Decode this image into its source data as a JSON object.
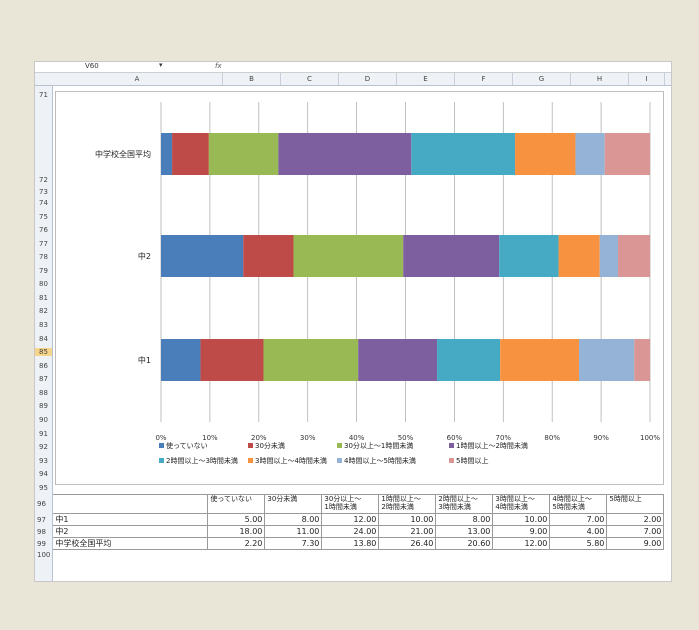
{
  "formula_bar": {
    "name_box": "V60",
    "dropdown": "▾",
    "fx": "fx"
  },
  "columns": [
    "A",
    "B",
    "C",
    "D",
    "E",
    "F",
    "G",
    "H",
    "I"
  ],
  "rows_top": [
    "71",
    "72",
    "73",
    "74",
    "75",
    "76",
    "77",
    "78",
    "79",
    "80",
    "81",
    "82",
    "83",
    "84",
    "85",
    "86",
    "87",
    "88",
    "89",
    "90",
    "91",
    "92",
    "93",
    "94",
    "95"
  ],
  "rows_table": [
    "96",
    "97",
    "98",
    "99",
    "100"
  ],
  "chart_data": {
    "type": "bar",
    "orientation": "horizontal",
    "stacked": "percent",
    "categories": [
      "中学校全国平均",
      "中2",
      "中1"
    ],
    "xticks": [
      "0%",
      "10%",
      "20%",
      "30%",
      "40%",
      "50%",
      "60%",
      "70%",
      "80%",
      "90%",
      "100%"
    ],
    "xlim": [
      0,
      100
    ],
    "grid": true,
    "legend_position": "bottom",
    "series": [
      {
        "name": "使っていない",
        "color": "#4a7ebb",
        "values": [
          2.2,
          18.0,
          5.0
        ]
      },
      {
        "name": "30分未満",
        "color": "#be4b48",
        "values": [
          7.3,
          11.0,
          8.0
        ]
      },
      {
        "name": "30分以上～1時間未満",
        "color": "#98b954",
        "values": [
          13.8,
          24.0,
          12.0
        ]
      },
      {
        "name": "1時間以上～2時間未満",
        "color": "#7d5fa0",
        "values": [
          26.4,
          21.0,
          10.0
        ]
      },
      {
        "name": "2時間以上～3時間未満",
        "color": "#46aac4",
        "values": [
          20.6,
          13.0,
          8.0
        ]
      },
      {
        "name": "3時間以上～4時間未満",
        "color": "#f69240",
        "values": [
          12.0,
          9.0,
          10.0
        ]
      },
      {
        "name": "4時間以上～5時間未満",
        "color": "#95b3d7",
        "values": [
          5.8,
          4.0,
          7.0
        ]
      },
      {
        "name": "5時間以上",
        "color": "#d99694",
        "values": [
          9.0,
          7.0,
          2.0
        ]
      }
    ]
  },
  "table": {
    "headers": [
      "使っていない",
      "30分未満",
      "30分以上～\n1時間未満",
      "1時間以上～\n2時間未満",
      "2時間以上～\n3時間未満",
      "3時間以上～\n4時間未満",
      "4時間以上～\n5時間未満",
      "5時間以上"
    ],
    "rows": [
      {
        "label": "中1",
        "values": [
          "5.00",
          "8.00",
          "12.00",
          "10.00",
          "8.00",
          "10.00",
          "7.00",
          "2.00"
        ]
      },
      {
        "label": "中2",
        "values": [
          "18.00",
          "11.00",
          "24.00",
          "21.00",
          "13.00",
          "9.00",
          "4.00",
          "7.00"
        ]
      },
      {
        "label": "中学校全国平均",
        "values": [
          "2.20",
          "7.30",
          "13.80",
          "26.40",
          "20.60",
          "12.00",
          "5.80",
          "9.00"
        ]
      }
    ]
  }
}
